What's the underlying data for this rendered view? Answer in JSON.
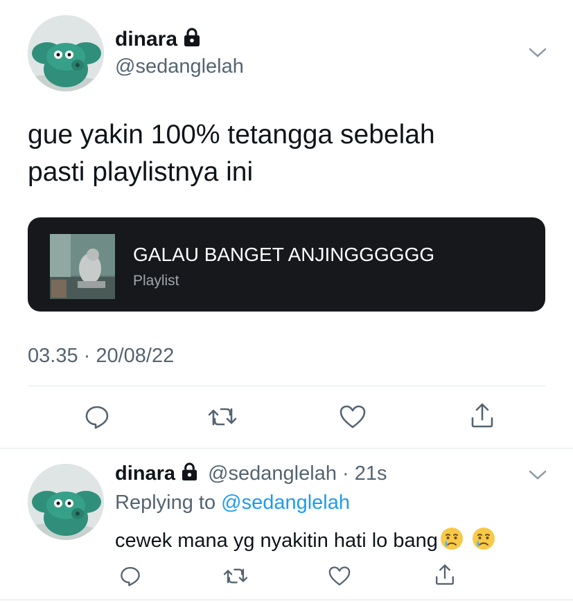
{
  "tweet": {
    "display_name": "dinara",
    "handle": "@sedanglelah",
    "text_line1": "gue yakin 100% tetangga sebelah",
    "text_line2": "pasti playlistnya ini",
    "card": {
      "title": "GALAU BANGET ANJINGGGGGG",
      "subtitle": "Playlist"
    },
    "timestamp": "03.35 · 20/08/22",
    "icons": {
      "reply": "reply-icon",
      "retweet": "retweet-icon",
      "like": "heart-icon",
      "share": "share-icon",
      "more": "chevron-down-icon",
      "protected": "lock-icon"
    }
  },
  "reply": {
    "display_name": "dinara",
    "handle_time": "@sedanglelah · 21s",
    "replying_prefix": "Replying to",
    "replying_handle": "@sedanglelah",
    "text": "cewek mana yg nyakitin hati lo bang",
    "emoji": [
      "crying-face-emoji",
      "crying-face-emoji"
    ]
  },
  "colors": {
    "link": "#1d9bf0",
    "secondary_text": "#536471",
    "card_bg": "#16181c",
    "avatar_green": "#2f8f7a"
  }
}
